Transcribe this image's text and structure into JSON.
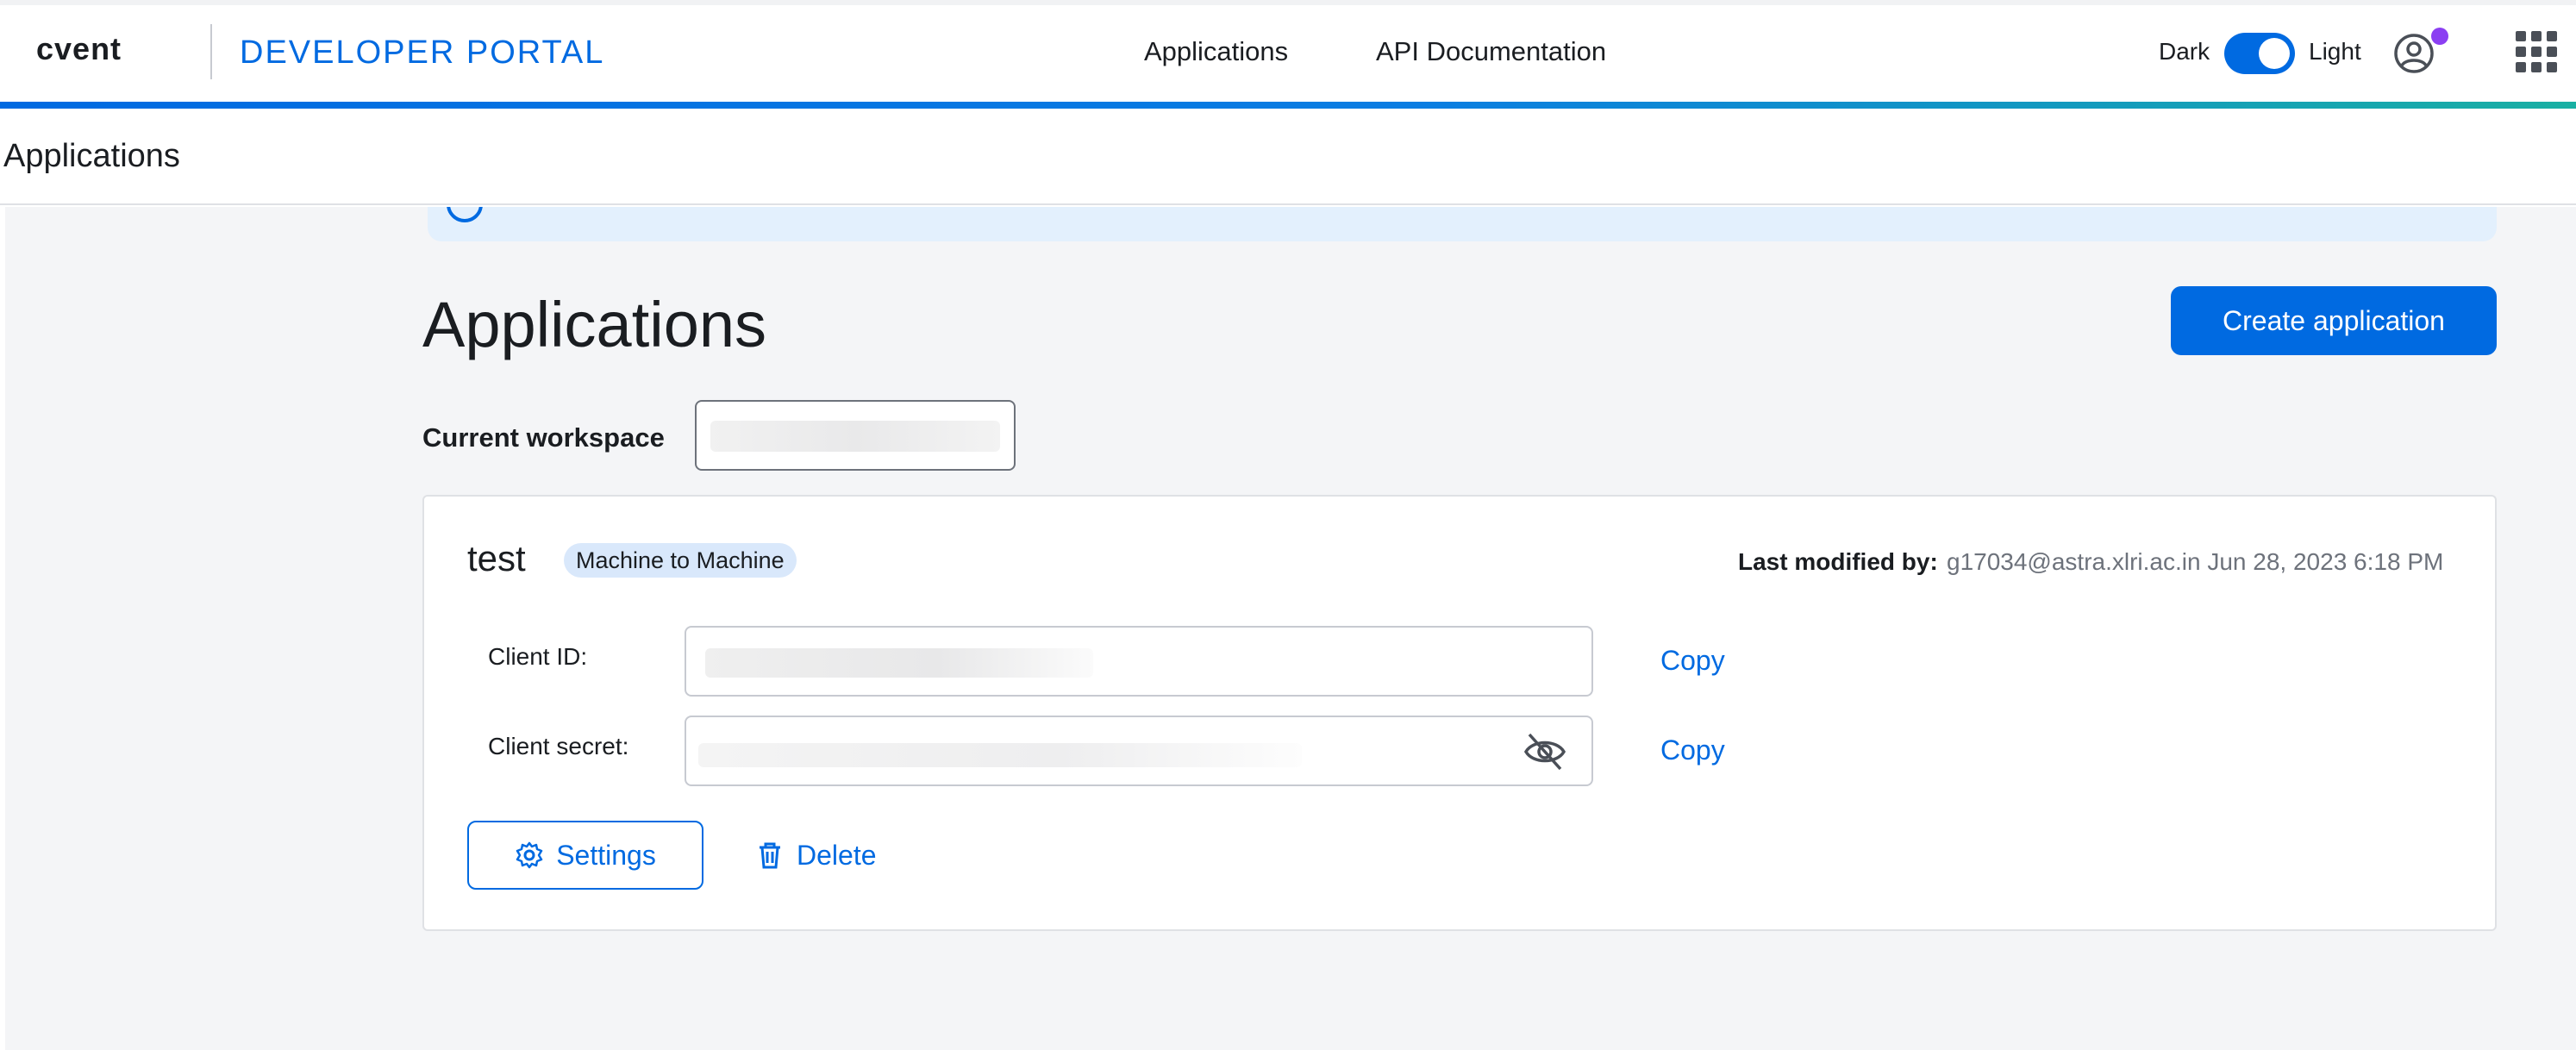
{
  "header": {
    "logo": "cvent",
    "portal_title": "DEVELOPER PORTAL",
    "nav": [
      {
        "label": "Applications"
      },
      {
        "label": "API Documentation"
      }
    ],
    "theme": {
      "dark_label": "Dark",
      "light_label": "Light",
      "selected": "Light"
    },
    "user_icon": "user-circle-icon",
    "apps_icon": "grid-menu-icon",
    "notification_dot_color": "#8b3ff2"
  },
  "subheader": {
    "title": "Applications"
  },
  "banner": {
    "icon": "info-icon"
  },
  "page": {
    "heading": "Applications",
    "create_button": "Create application",
    "workspace_label": "Current workspace"
  },
  "application": {
    "name": "test",
    "type_badge": "Machine to Machine",
    "modified_label": "Last modified by:",
    "modified_value": "g17034@astra.xlri.ac.in Jun 28, 2023 6:18 PM",
    "client_id_label": "Client ID:",
    "client_secret_label": "Client secret:",
    "copy_label": "Copy",
    "settings_label": "Settings",
    "delete_label": "Delete"
  },
  "colors": {
    "accent": "#006ae1",
    "banner_bg": "#e3f0fd",
    "page_bg": "#f4f5f7",
    "badge_bg": "#d9e8fb"
  }
}
